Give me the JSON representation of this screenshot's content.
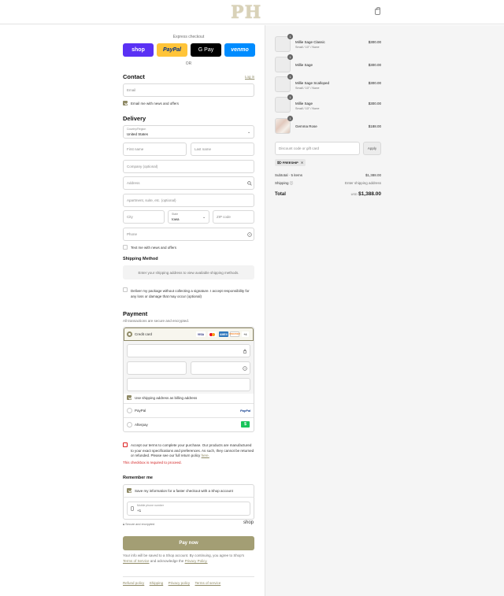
{
  "header": {
    "logo": "PH",
    "cart_icon": "shopping-bag-icon"
  },
  "express": {
    "label": "Express checkout",
    "buttons": [
      {
        "label": "shop",
        "bg": "#5a31f4",
        "fg": "#ffffff"
      },
      {
        "label": "PayPal",
        "bg": "#ffc439",
        "fg": "#003087"
      },
      {
        "label": "G Pay",
        "bg": "#000000",
        "fg": "#ffffff"
      },
      {
        "label": "venmo",
        "bg": "#008cff",
        "fg": "#ffffff"
      }
    ],
    "or": "OR"
  },
  "contact": {
    "title": "Contact",
    "login": "Log in",
    "email_placeholder": "Email",
    "news_label": "Email me with news and offers"
  },
  "delivery": {
    "title": "Delivery",
    "country_label": "Country/Region",
    "country_value": "United States",
    "first_name": "First name",
    "last_name": "Last name",
    "company": "Company (optional)",
    "address": "Address",
    "apartment": "Apartment, suite, etc. (optional)",
    "city": "City",
    "state_label": "State",
    "state_value": "Iowa",
    "zip": "ZIP code",
    "phone": "Phone",
    "text_me": "Text me with news and offers"
  },
  "shipping_method": {
    "title": "Shipping Method",
    "info": "Enter your shipping address to view available shipping methods.",
    "signature_line1": "Deliver my package without collecting a signature. I accept responsibility for",
    "signature_line2": "any loss or damage that may occur (optional)"
  },
  "payment": {
    "title": "Payment",
    "subtitle": "All transactions are secure and encrypted.",
    "credit_card": "Credit card",
    "card_brands": [
      "VISA",
      "MC",
      "AMEX",
      "DISCOVER",
      "+4"
    ],
    "billing_same": "Use shipping address as billing address",
    "paypal": "PayPal",
    "paypal_logo": "PayPal",
    "afterpay": "Afterpay",
    "afterpay_logo": "$"
  },
  "terms": {
    "line1": "Accept our terms to complete your purchase. Our products are manufactured",
    "line2": "to your exact specifications and preferences. As such, they cannot be returned",
    "line3": "or refunded. Please see our full return policy",
    "here": "here.",
    "error": "This checkbox is required to proceed."
  },
  "remember": {
    "title": "Remember me",
    "save_label": "Save my information for a faster checkout with a Shop account",
    "phone_label": "Mobile phone number",
    "phone_value": "+1",
    "secure": "Secure and encrypted",
    "shop": "shop"
  },
  "pay_button": "Pay now",
  "disclaimer": {
    "line1": "Your info will be saved to a Shop account. By continuing, you agree to Shop's",
    "terms_link": "Terms of Service",
    "mid": "and acknowledge the",
    "privacy_link": "Privacy Policy."
  },
  "footer_links": [
    "Refund policy",
    "Shipping",
    "Privacy policy",
    "Terms of service"
  ],
  "summary": {
    "items": [
      {
        "qty": "1",
        "name": "Millie Sage Classic",
        "variant": "Small / 10\" / None",
        "price": "$300.00"
      },
      {
        "qty": "1",
        "name": "Millie Sage",
        "variant": "",
        "price": "$300.00"
      },
      {
        "qty": "1",
        "name": "Millie Sage Scalloped",
        "variant": "Small / 10\" / None",
        "price": "$300.00"
      },
      {
        "qty": "1",
        "name": "Millie Sage",
        "variant": "Small / 10\" / None",
        "price": "$300.00"
      },
      {
        "qty": "1",
        "name": "Gemma Rose",
        "variant": "",
        "price": "$188.00"
      }
    ],
    "discount_placeholder": "Discount code or gift card",
    "apply": "Apply",
    "tag": "FREESHIP",
    "subtotal_label": "Subtotal · 5 items",
    "subtotal_value": "$1,388.00",
    "shipping_label": "Shipping",
    "shipping_value": "Enter shipping address",
    "total_label": "Total",
    "currency": "USD",
    "total_value": "$1,388.00"
  },
  "colors": {
    "accent": "#8f8a66",
    "error": "#d22222",
    "pay_button": "#a39e74"
  }
}
